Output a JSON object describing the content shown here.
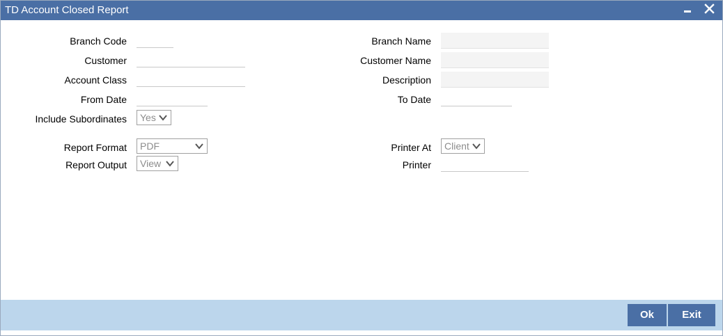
{
  "window": {
    "title": "TD Account Closed Report"
  },
  "form": {
    "branch_code_label": "Branch Code",
    "customer_label": "Customer",
    "account_class_label": "Account Class",
    "from_date_label": "From Date",
    "include_subordinates_label": "Include Subordinates",
    "include_subordinates_value": "Yes",
    "report_format_label": "Report Format",
    "report_format_value": "PDF",
    "report_output_label": "Report Output",
    "report_output_value": "View",
    "branch_name_label": "Branch Name",
    "customer_name_label": "Customer Name",
    "description_label": "Description",
    "to_date_label": "To Date",
    "printer_at_label": "Printer At",
    "printer_at_value": "Client",
    "printer_label": "Printer"
  },
  "footer": {
    "ok_label": "Ok",
    "exit_label": "Exit"
  },
  "colors": {
    "titlebar": "#4a6fa5",
    "footer": "#bcd6ec",
    "button": "#4a6fa5"
  },
  "icons": {
    "minimize": "minimize-icon",
    "close": "close-icon",
    "dropdown": "chevron-down-icon"
  }
}
